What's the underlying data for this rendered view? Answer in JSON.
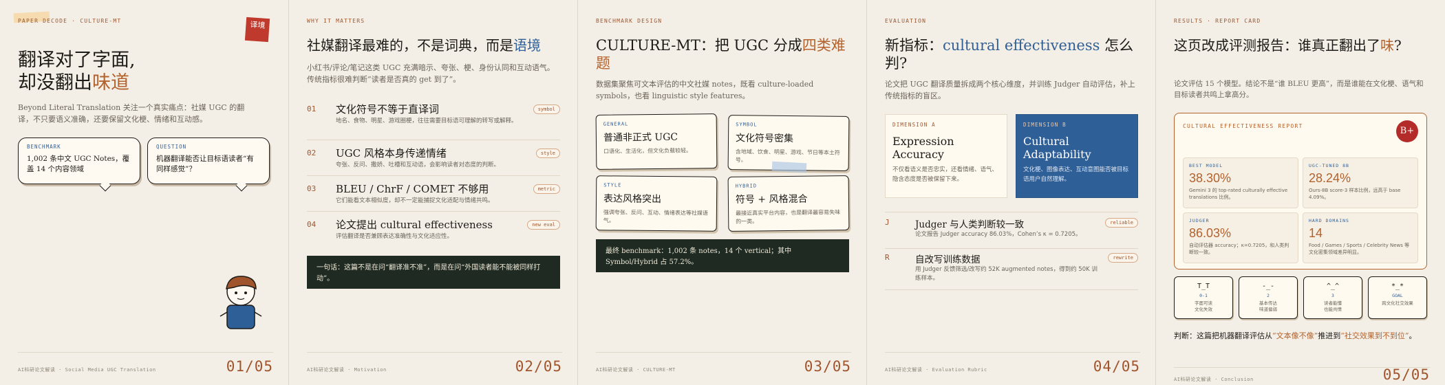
{
  "slides": [
    {
      "eyebrow": "PAPER DECODE · CULTURE-MT",
      "seal": "译境",
      "title_l1": "翻译对了字面,",
      "title_l2_pre": "却没翻出",
      "title_l2_accent": "味道",
      "lead_en": "Beyond Literal Translation",
      "lead_zh": " 关注一个真实痛点：社媒 UGC 的翻译，不只要语义准确，还要保留文化梗、情绪和互动感。",
      "bubbles": [
        {
          "tag": "BENCHMARK",
          "text": "1,002 条中文 UGC Notes，覆盖 14 个内容领域"
        },
        {
          "tag": "QUESTION",
          "text": "机器翻译能否让目标语读者“有同样感觉”？"
        }
      ],
      "footer": "AI科研论文解读 · Social Media UGC Translation",
      "page": "01/05"
    },
    {
      "eyebrow": "WHY IT MATTERS",
      "title_pre": "社媒翻译最难的，不是词典，而是",
      "title_accent": "语境",
      "lead": "小红书/评论/笔记这类 UGC 充满暗示、夸张、梗、身份认同和互动语气。传统指标很难判断“读者是否真的 get 到了”。",
      "rows": [
        {
          "num": "01",
          "title": "文化符号不等于直译词",
          "desc": "地名、食物、明星、游戏圈梗，往往需要目标语可理解的转写或解释。",
          "chip": "symbol"
        },
        {
          "num": "02",
          "title": "UGC 风格本身传递情绪",
          "desc": "夸张、反问、撒娇、吐槽和互动语，会影响读者对态度的判断。",
          "chip": "style"
        },
        {
          "num": "03",
          "title": "BLEU / ChrF / COMET 不够用",
          "desc": "它们能看文本相似度，却不一定能捕捉文化适配与情绪共鸣。",
          "chip": "metric"
        },
        {
          "num": "04",
          "title": "论文提出 cultural effectiveness",
          "desc": "评估翻译是否兼顾表达准确性与文化适应性。",
          "chip": "new eval"
        }
      ],
      "summary": "一句话：这篇不是在问“翻译准不准”，而是在问“外国读者能不能被同样打动”。",
      "footer": "AI科研论文解读 · Motivation",
      "page": "02/05"
    },
    {
      "eyebrow": "BENCHMARK DESIGN",
      "title_pre": "CULTURE-MT：把 UGC 分成",
      "title_accent": "四类难题",
      "lead": "数据集聚焦可文本评估的中文社媒 notes，既看 culture-loaded symbols，也看 linguistic style features。",
      "cards": [
        {
          "tag": "GENERAL",
          "title": "普通非正式 UGC",
          "desc": "口语化、生活化，但文化负载较轻。"
        },
        {
          "tag": "SYMBOL",
          "title": "文化符号密集",
          "desc": "含地域、饮食、明星、游戏、节日等本土符号。"
        },
        {
          "tag": "STYLE",
          "title": "表达风格突出",
          "desc": "强调夸张、反问、互动、情绪表达等社媒语气。"
        },
        {
          "tag": "HYBRID",
          "title": "符号 + 风格混合",
          "desc": "最接近真实平台内容，也是翻译最容易失味的一类。"
        }
      ],
      "summary": "最终 benchmark：1,002 条 notes，14 个 vertical；其中 Symbol/Hybrid 占 57.2%。",
      "footer": "AI科研论文解读 · CULTURE-MT",
      "page": "03/05"
    },
    {
      "eyebrow": "EVALUATION",
      "title_pre": "新指标：",
      "title_accent": "cultural effectiveness",
      "title_post": " 怎么判?",
      "lead": "论文把 UGC 翻译质量拆成两个核心维度，并训练 Judger 自动评估，补上传统指标的盲区。",
      "dims": [
        {
          "tag": "DIMENSION A",
          "title": "Expression Accuracy",
          "desc": "不仅看语义是否忠实，还看情绪、语气、隐含态度是否被保留下来。"
        },
        {
          "tag": "DIMENSION B",
          "title": "Cultural Adaptability",
          "desc": "文化梗、图像表达、互动意图能否被目标语用户自然理解。"
        }
      ],
      "rows": [
        {
          "key": "J",
          "title": "Judger 与人类判断较一致",
          "desc": "论文报告 Judger accuracy 86.03%，Cohen’s κ = 0.7205。",
          "chip": "reliable"
        },
        {
          "key": "R",
          "title": "自改写训练数据",
          "desc": "用 Judger 反馈筛选/改写约 52K augmented notes，得到约 50K 训练样本。",
          "chip": "rewrite"
        }
      ],
      "footer": "AI科研论文解读 · Evaluation Rubric",
      "page": "04/05"
    },
    {
      "eyebrow": "RESULTS · REPORT CARD",
      "title_pre": "这页改成评测报告：谁真正翻出了",
      "title_accent": "味",
      "title_post": "?",
      "lead": "论文评估 15 个模型。结论不是“谁 BLEU 更高”，而是谁能在文化梗、语气和目标读者共鸣上拿高分。",
      "report_title": "CULTURAL EFFECTIVENESS REPORT",
      "grade": "B+",
      "metrics": [
        {
          "tag": "BEST MODEL",
          "value": "38.30%",
          "desc": "Gemini 3 的 top-rated culturally effective translations 比例。"
        },
        {
          "tag": "UGC-TUNED 8B",
          "value": "28.24%",
          "desc": "Ours-8B score-3 样本比例，远高于 base 4.09%。"
        },
        {
          "tag": "JUDGER",
          "value": "86.03%",
          "desc": "自动评估器 accuracy；κ=0.7205，和人类判断较一致。"
        },
        {
          "tag": "HARD DOMAINS",
          "value": "14",
          "desc": "Food / Games / Sports / Celebrity News 等文化密集领域差异明显。"
        }
      ],
      "scale": [
        {
          "face": "T_T",
          "num": "0-1",
          "label": "字面可读\n文化失效"
        },
        {
          "face": "-_-",
          "num": "2",
          "label": "基本传达\n味道偏弱"
        },
        {
          "face": "^_^",
          "num": "3",
          "label": "读者能懂\n也能共情"
        },
        {
          "face": "*_*",
          "num": "GOAL",
          "label": "跨文化社交效果"
        }
      ],
      "verdict_pre": "判断：这篇把机器翻译评估从",
      "verdict_q1": "“文本像不像”",
      "verdict_mid": "推进到",
      "verdict_q2": "“社交效果到不到位”",
      "verdict_post": "。",
      "footer": "AI科研论文解读 · Conclusion",
      "page": "05/05"
    }
  ]
}
